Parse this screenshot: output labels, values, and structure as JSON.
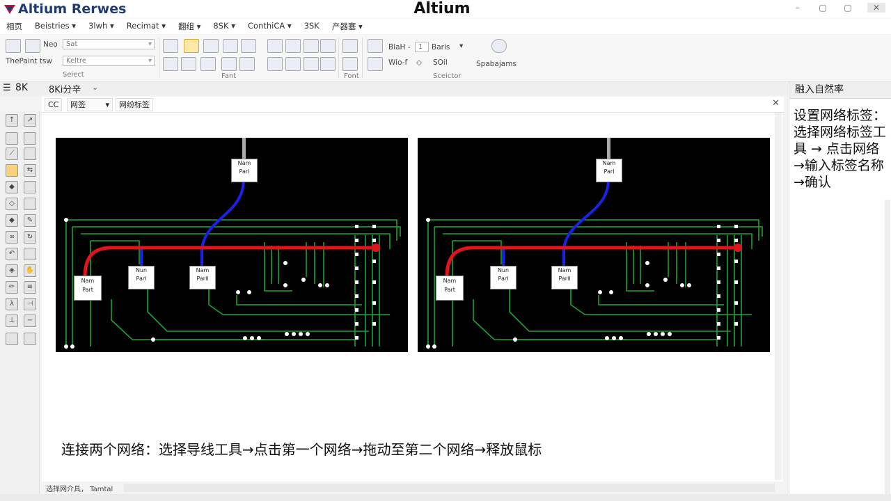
{
  "app": {
    "brand": "Altium Rerwes",
    "title": "Altium",
    "window_controls": [
      "–",
      "▢",
      "▢",
      "✕"
    ]
  },
  "menu": [
    "相页",
    "Beistries ▾",
    "3lwh ▾",
    "Recimat ▾",
    "翻组 ▾",
    "8SK ▾",
    "ConthiCA ▾",
    "3SK",
    "产器塞 ▾"
  ],
  "ribbon": {
    "net_label": "Neo",
    "net_value": "Sat",
    "paint_label": "ThePaint tsw",
    "paint_value": "Keltre",
    "group_select": "Seiect",
    "group_font1": "Fant",
    "group_font2": "Font",
    "blah_label": "BlaH -",
    "blah_value": "1",
    "blah_suffix": "Baris",
    "wid_label": "Wio-f",
    "wid_value": "SOil",
    "group_selector": "Sceictor",
    "spare_label": "Spabajams"
  },
  "subtoolbar": {
    "zoom": "8K",
    "resolution": "8Ki分辛"
  },
  "tabs": {
    "first": "CC",
    "dropdown": "网签",
    "active": "网纷标签"
  },
  "colors": {
    "pcb_bg": "#000000",
    "trace_green": "#1aa52f",
    "wire_red": "#e0141a",
    "wire_blue": "#1a22e6"
  },
  "pcb": {
    "labels": [
      {
        "line1": "Nam",
        "line2": "Parl"
      },
      {
        "line1": "Nun",
        "line2": "Parl"
      },
      {
        "line1": "Nam",
        "line2": "Parll"
      },
      {
        "line1": "Nam",
        "line2": "Part"
      }
    ]
  },
  "caption": "连接两个网络：选择导线工具→点击第一个网络→拖动至第二个网络→释放鼠标",
  "rightpanel": {
    "header": "融入自然率",
    "text": "设置网络标签：选择网络标签工具 → 点击网络→输入标签名称→确认"
  },
  "status": "选择网介具， Tamtal"
}
